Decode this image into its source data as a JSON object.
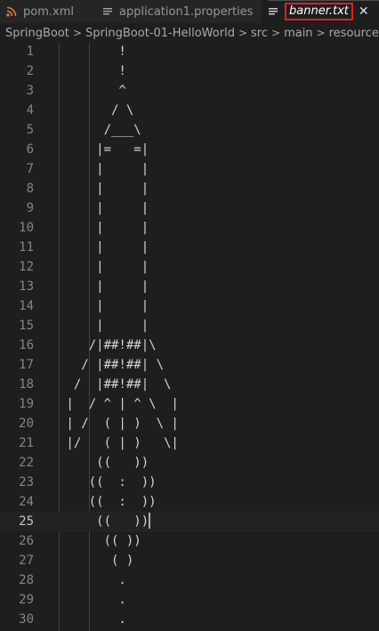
{
  "tabs": [
    {
      "label": "pom.xml",
      "icon": "rss-icon",
      "icon_color": "#e37933",
      "active": false
    },
    {
      "label": "application1.properties",
      "icon": "lines-icon",
      "icon_color": "#a0a0a0",
      "active": false
    },
    {
      "label": "banner.txt",
      "icon": "lines-icon",
      "icon_color": "#cccccc",
      "active": true,
      "close": "✕"
    }
  ],
  "breadcrumb": [
    "SpringBoot",
    "SpringBoot-01-HelloWorld",
    "src",
    "main",
    "resources",
    ""
  ],
  "editor": {
    "active_line": 25,
    "lines": [
      {
        "n": "1",
        "text": "        !"
      },
      {
        "n": "2",
        "text": "        !"
      },
      {
        "n": "3",
        "text": "        ^"
      },
      {
        "n": "4",
        "text": "       / \\"
      },
      {
        "n": "5",
        "text": "      /___\\"
      },
      {
        "n": "6",
        "text": "     |=   =|"
      },
      {
        "n": "7",
        "text": "     |     |"
      },
      {
        "n": "8",
        "text": "     |     |"
      },
      {
        "n": "9",
        "text": "     |     |"
      },
      {
        "n": "10",
        "text": "     |     |"
      },
      {
        "n": "11",
        "text": "     |     |"
      },
      {
        "n": "12",
        "text": "     |     |"
      },
      {
        "n": "13",
        "text": "     |     |"
      },
      {
        "n": "14",
        "text": "     |     |"
      },
      {
        "n": "15",
        "text": "     |     |"
      },
      {
        "n": "16",
        "text": "    /|##!##|\\"
      },
      {
        "n": "17",
        "text": "   / |##!##| \\"
      },
      {
        "n": "18",
        "text": "  /  |##!##|  \\"
      },
      {
        "n": "19",
        "text": " |  / ^ | ^ \\  |"
      },
      {
        "n": "20",
        "text": " | /  ( | )  \\ |"
      },
      {
        "n": "21",
        "text": " |/   ( | )   \\|"
      },
      {
        "n": "22",
        "text": "     ((   ))"
      },
      {
        "n": "23",
        "text": "    ((  :  ))"
      },
      {
        "n": "24",
        "text": "    ((  :  ))"
      },
      {
        "n": "25",
        "text": "     ((   ))"
      },
      {
        "n": "26",
        "text": "      (( ))"
      },
      {
        "n": "27",
        "text": "       ( )"
      },
      {
        "n": "28",
        "text": "        ."
      },
      {
        "n": "29",
        "text": "        ."
      },
      {
        "n": "30",
        "text": "        ."
      }
    ]
  }
}
